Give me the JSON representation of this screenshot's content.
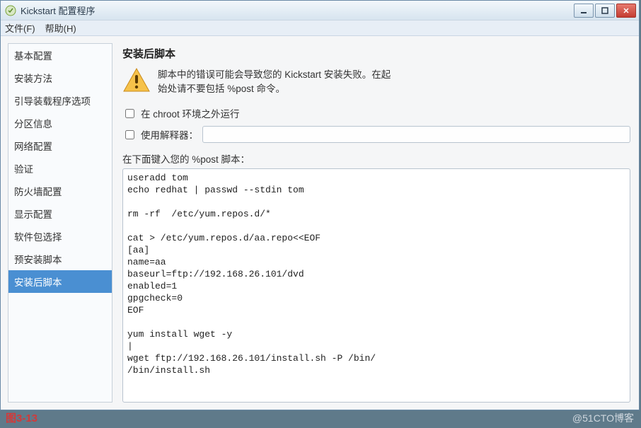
{
  "titlebar": {
    "title": "Kickstart 配置程序"
  },
  "menubar": {
    "file": "文件(F)",
    "help": "帮助(H)"
  },
  "sidebar": {
    "items": [
      {
        "label": "基本配置"
      },
      {
        "label": "安装方法"
      },
      {
        "label": "引导装载程序选项"
      },
      {
        "label": "分区信息"
      },
      {
        "label": "网络配置"
      },
      {
        "label": "验证"
      },
      {
        "label": "防火墙配置"
      },
      {
        "label": "显示配置"
      },
      {
        "label": "软件包选择"
      },
      {
        "label": "预安装脚本"
      },
      {
        "label": "安装后脚本"
      }
    ],
    "selected_index": 10
  },
  "main": {
    "heading": "安装后脚本",
    "warning_line1": "脚本中的错误可能会导致您的  Kickstart  安装失败。在起",
    "warning_line2": "始处请不要包括  %post 命令。",
    "checkbox_chroot": "在  chroot 环境之外运行",
    "checkbox_interpreter": "使用解释器：",
    "interpreter_value": "",
    "script_label": "在下面键入您的  %post 脚本：",
    "script_content": "useradd tom\necho redhat | passwd --stdin tom\n\nrm -rf  /etc/yum.repos.d/*\n\ncat > /etc/yum.repos.d/aa.repo<<EOF\n[aa]\nname=aa\nbaseurl=ftp://192.168.26.101/dvd\nenabled=1\ngpgcheck=0\nEOF\n\nyum install wget -y\n|\nwget ftp://192.168.26.101/install.sh -P /bin/\n/bin/install.sh"
  },
  "footer": {
    "caption": "图3-13",
    "watermark": "@51CTO博客"
  }
}
